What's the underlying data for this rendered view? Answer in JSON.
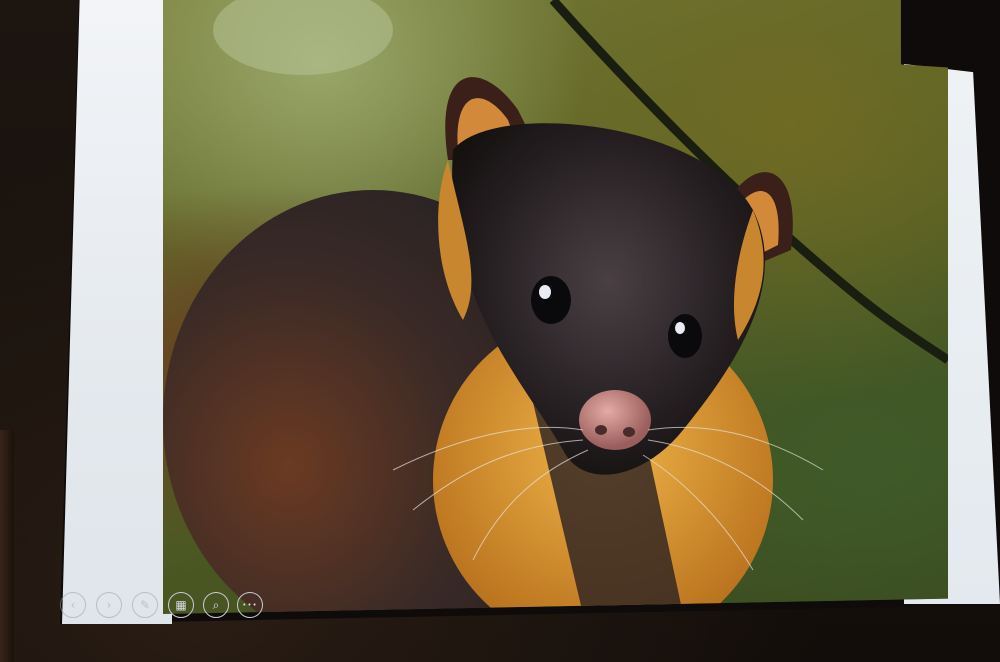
{
  "scene": {
    "subject": "marten",
    "colors": {
      "fur_dark": "#1f1a1c",
      "fur_gold": "#d9952c",
      "nose": "#c98a84",
      "background": "#566226"
    }
  },
  "presenter_controls": [
    {
      "name": "previous-slide-button",
      "icon": "chevron-left-icon",
      "glyph": "‹",
      "enabled": false
    },
    {
      "name": "next-slide-button",
      "icon": "chevron-right-icon",
      "glyph": "›",
      "enabled": false
    },
    {
      "name": "pen-tool-button",
      "icon": "pen-icon",
      "glyph": "✎",
      "enabled": false
    },
    {
      "name": "see-all-slides-button",
      "icon": "slides-grid-icon",
      "glyph": "▦",
      "enabled": true
    },
    {
      "name": "zoom-button",
      "icon": "magnifier-icon",
      "glyph": "⌕",
      "enabled": true
    },
    {
      "name": "more-options-button",
      "icon": "ellipsis-icon",
      "glyph": "•••",
      "enabled": true
    }
  ]
}
